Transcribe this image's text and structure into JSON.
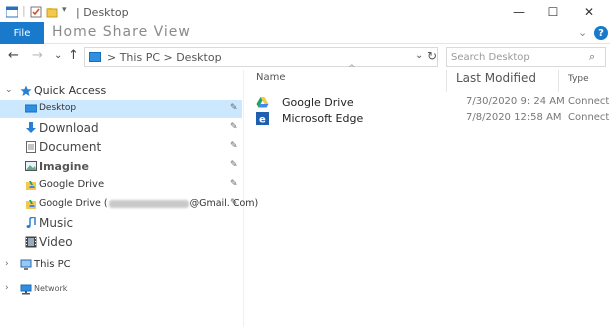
{
  "window": {
    "title": "| Desktop"
  },
  "titlebar": {
    "minimize": "—",
    "maximize": "☐",
    "close": "✕"
  },
  "ribbon": {
    "file_label": "File",
    "tabs_label": "Home Share View",
    "chevron": "⌄",
    "help": "?"
  },
  "nav": {
    "back": "←",
    "forward": "→",
    "recent": "⌄",
    "up": "↑",
    "address": "> This PC > Desktop",
    "address_dropdown": "⌄",
    "refresh": "↻",
    "search_placeholder": "Search Desktop",
    "search_icon": "⌕"
  },
  "sidebar": {
    "quick_access": "Quick Access",
    "items": [
      {
        "label": "Desktop",
        "pinned": true,
        "icon": "desktop-icon"
      },
      {
        "label": "Download",
        "pinned": true,
        "icon": "download-icon"
      },
      {
        "label": "Document",
        "pinned": true,
        "icon": "document-icon"
      },
      {
        "label": "Imagine",
        "pinned": true,
        "icon": "picture-icon"
      },
      {
        "label": "Google Drive",
        "pinned": true,
        "icon": "google-drive-icon"
      },
      {
        "label_prefix": "Google Drive (",
        "label_suffix": "@Gmail. Com)",
        "pinned": true,
        "icon": "google-drive-icon"
      },
      {
        "label": "Music",
        "pinned": false,
        "icon": "music-icon"
      },
      {
        "label": "Video",
        "pinned": false,
        "icon": "video-icon"
      }
    ],
    "this_pc": "This PC",
    "network": "Network",
    "pin_glyph": "📌"
  },
  "table": {
    "columns": [
      "Name",
      "Last Modified",
      "Type"
    ],
    "sort_glyph": "^",
    "rows": [
      {
        "name": "Google Drive",
        "date": "7/30/2020 9: 24 AM",
        "type": "Connect",
        "icon": "google-drive-icon"
      },
      {
        "name": "Microsoft Edge",
        "date": "7/8/2020 12:58 AM",
        "type": "Connect",
        "icon": "edge-icon"
      }
    ]
  },
  "colors": {
    "accent": "#1979ca",
    "selected": "#cce8ff"
  }
}
